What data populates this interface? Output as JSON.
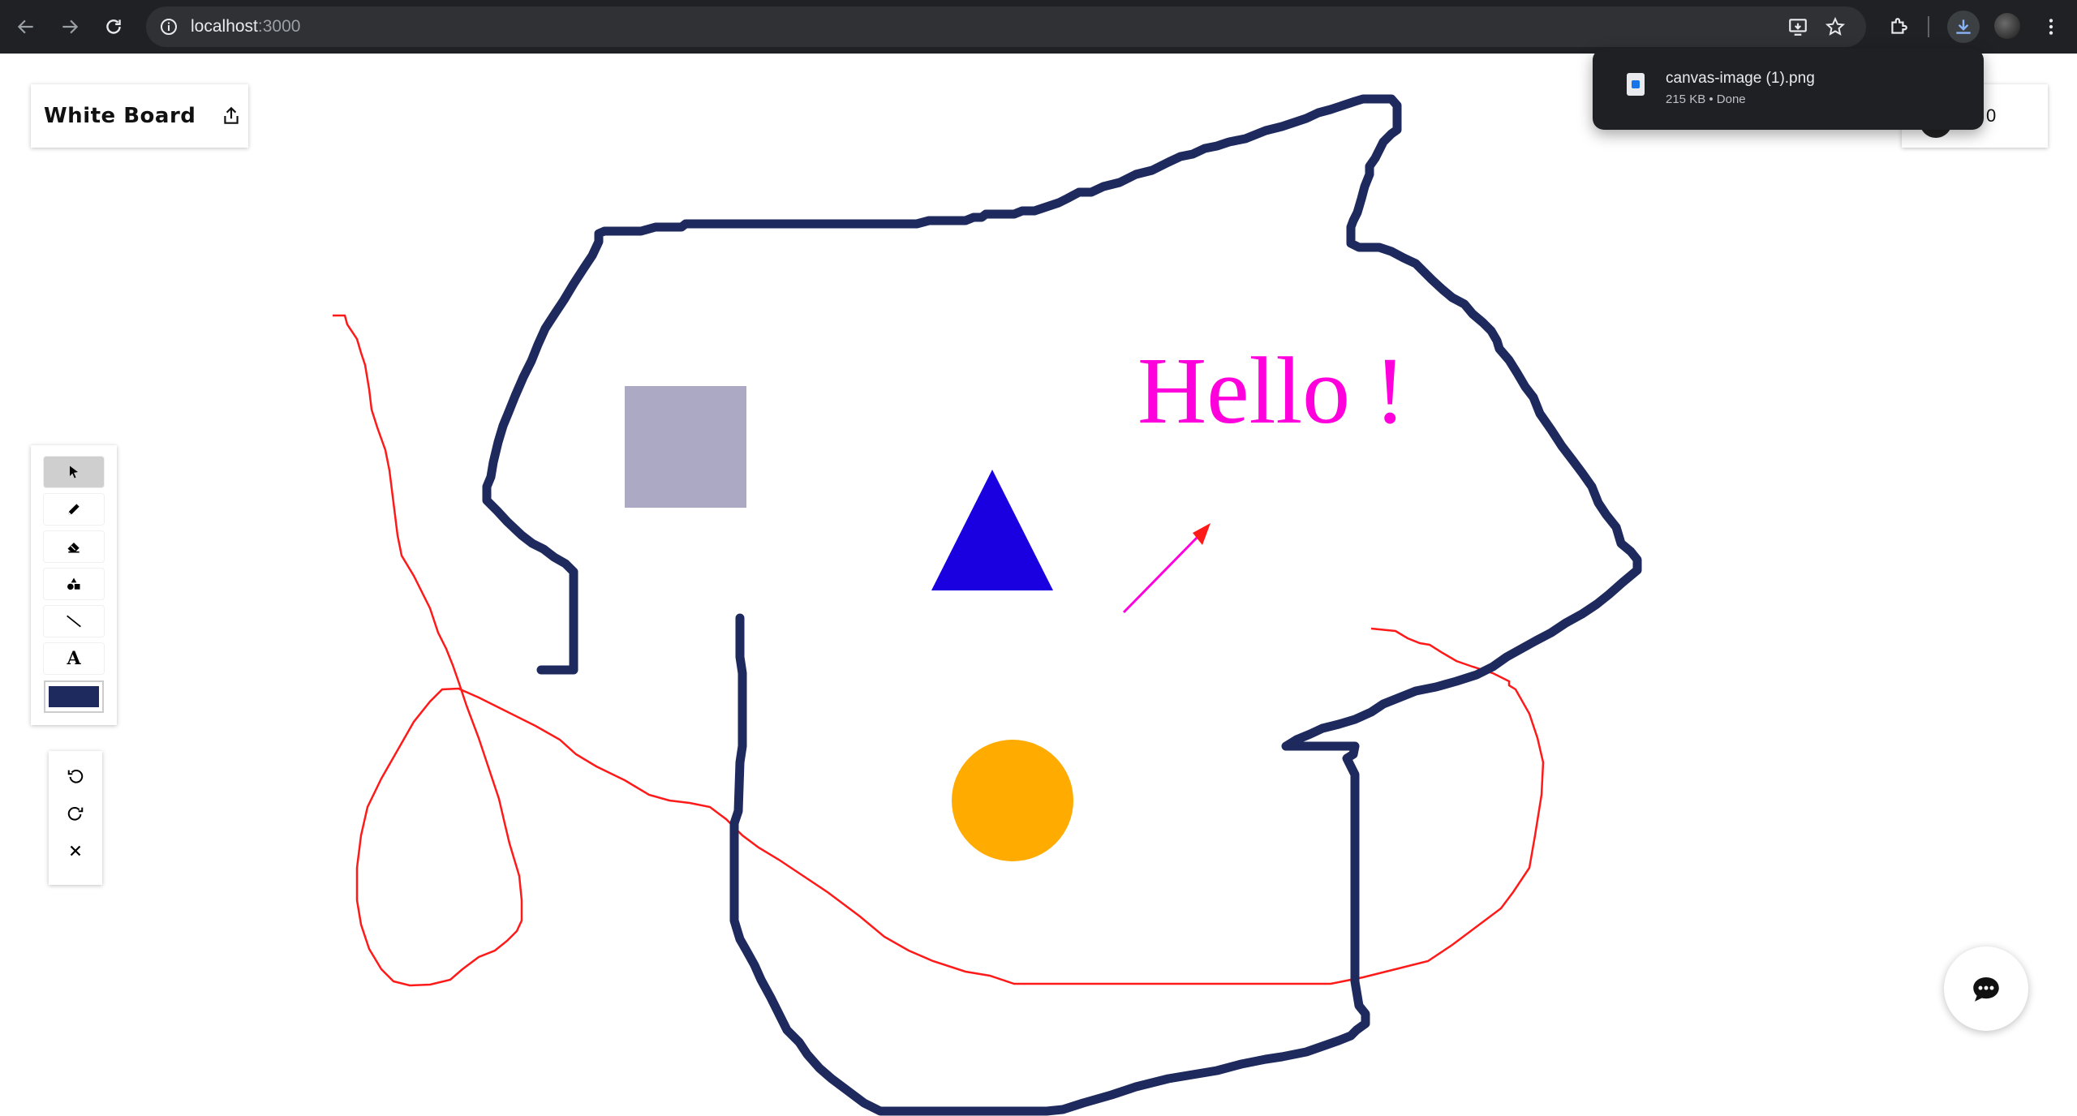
{
  "browser": {
    "url_host": "localhost",
    "url_port": ":3000"
  },
  "download": {
    "file_name": "canvas-image (1).png",
    "status": "215 KB • Done"
  },
  "app": {
    "title": "White Board",
    "user_count": "0",
    "stroke_color": "#1e2a5e"
  },
  "canvas": {
    "text": "Hello !",
    "text_color": "#ff00dd",
    "colors": {
      "outline": "#1e2a5e",
      "freehand": "#ff1a1a",
      "square": "#aba9c3",
      "triangle": "#1a00e0",
      "circle": "#ffab00",
      "arrow": "#ff00dd"
    }
  },
  "toolbar": {
    "tools": [
      "select-icon",
      "pencil-icon",
      "eraser-icon",
      "shapes-icon",
      "line-icon",
      "text-icon"
    ],
    "text_tool_label": "A"
  },
  "history": [
    "undo-icon",
    "redo-icon",
    "clear-icon"
  ]
}
